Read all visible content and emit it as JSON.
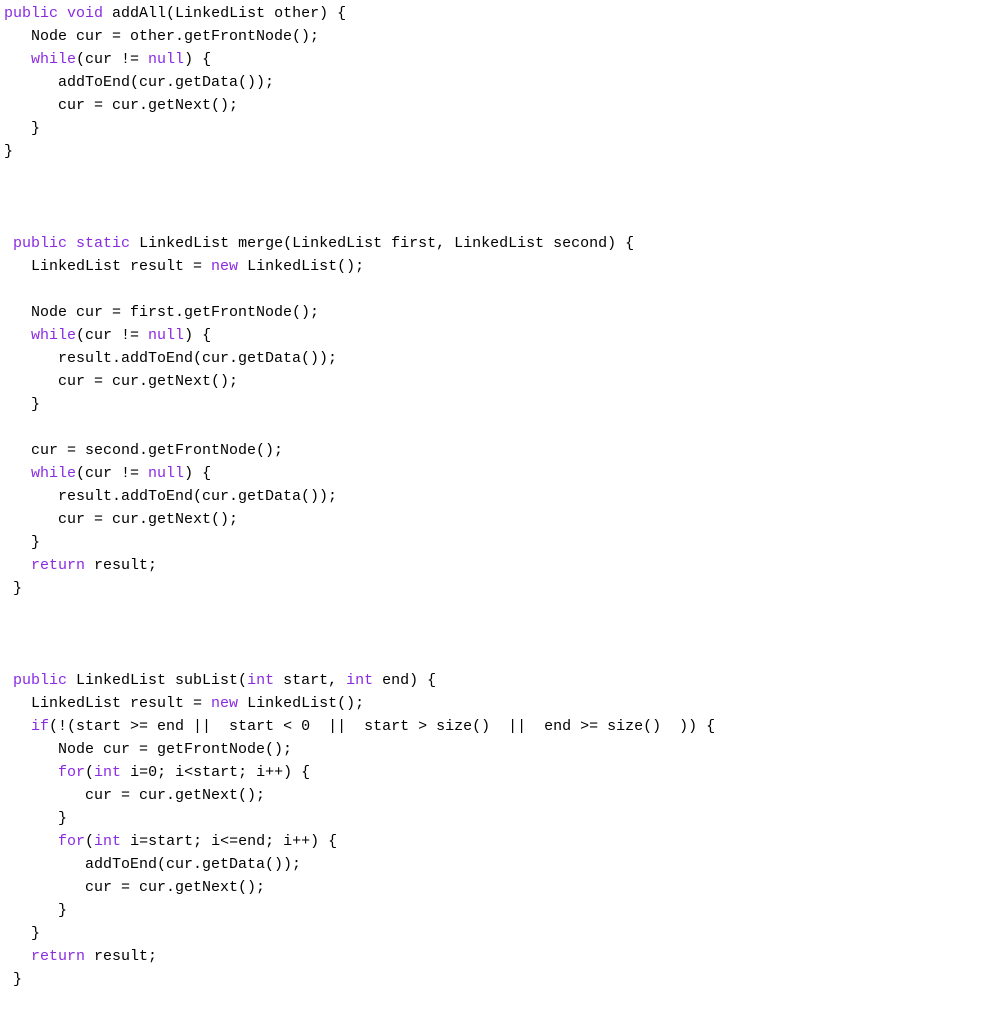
{
  "colors": {
    "keyword": "#8a2be2",
    "text": "#000000",
    "background": "#ffffff"
  },
  "keywords": [
    "public",
    "void",
    "static",
    "new",
    "int",
    "while",
    "for",
    "if",
    "return",
    "null"
  ],
  "code": {
    "tokens": [
      [
        [
          "kw",
          "public"
        ],
        [
          "p",
          " "
        ],
        [
          "kw",
          "void"
        ],
        [
          "p",
          " addAll(LinkedList other) {"
        ]
      ],
      [
        [
          "p",
          "   Node cur = other.getFrontNode();"
        ]
      ],
      [
        [
          "p",
          "   "
        ],
        [
          "kw",
          "while"
        ],
        [
          "p",
          "(cur != "
        ],
        [
          "kw",
          "null"
        ],
        [
          "p",
          ") {"
        ]
      ],
      [
        [
          "p",
          "      addToEnd(cur.getData());"
        ]
      ],
      [
        [
          "p",
          "      cur = cur.getNext();"
        ]
      ],
      [
        [
          "p",
          "   }"
        ]
      ],
      [
        [
          "p",
          "}"
        ]
      ],
      [
        [
          "p",
          ""
        ]
      ],
      [
        [
          "p",
          ""
        ]
      ],
      [
        [
          "p",
          ""
        ]
      ],
      [
        [
          "p",
          " "
        ],
        [
          "kw",
          "public"
        ],
        [
          "p",
          " "
        ],
        [
          "kw",
          "static"
        ],
        [
          "p",
          " LinkedList merge(LinkedList first, LinkedList second) {"
        ]
      ],
      [
        [
          "p",
          "   LinkedList result = "
        ],
        [
          "kw",
          "new"
        ],
        [
          "p",
          " LinkedList();"
        ]
      ],
      [
        [
          "p",
          ""
        ]
      ],
      [
        [
          "p",
          "   Node cur = first.getFrontNode();"
        ]
      ],
      [
        [
          "p",
          "   "
        ],
        [
          "kw",
          "while"
        ],
        [
          "p",
          "(cur != "
        ],
        [
          "kw",
          "null"
        ],
        [
          "p",
          ") {"
        ]
      ],
      [
        [
          "p",
          "      result.addToEnd(cur.getData());"
        ]
      ],
      [
        [
          "p",
          "      cur = cur.getNext();"
        ]
      ],
      [
        [
          "p",
          "   }"
        ]
      ],
      [
        [
          "p",
          ""
        ]
      ],
      [
        [
          "p",
          "   cur = second.getFrontNode();"
        ]
      ],
      [
        [
          "p",
          "   "
        ],
        [
          "kw",
          "while"
        ],
        [
          "p",
          "(cur != "
        ],
        [
          "kw",
          "null"
        ],
        [
          "p",
          ") {"
        ]
      ],
      [
        [
          "p",
          "      result.addToEnd(cur.getData());"
        ]
      ],
      [
        [
          "p",
          "      cur = cur.getNext();"
        ]
      ],
      [
        [
          "p",
          "   }"
        ]
      ],
      [
        [
          "p",
          "   "
        ],
        [
          "kw",
          "return"
        ],
        [
          "p",
          " result;"
        ]
      ],
      [
        [
          "p",
          " }"
        ]
      ],
      [
        [
          "p",
          ""
        ]
      ],
      [
        [
          "p",
          ""
        ]
      ],
      [
        [
          "p",
          ""
        ]
      ],
      [
        [
          "p",
          " "
        ],
        [
          "kw",
          "public"
        ],
        [
          "p",
          " LinkedList subList("
        ],
        [
          "kw",
          "int"
        ],
        [
          "p",
          " start, "
        ],
        [
          "kw",
          "int"
        ],
        [
          "p",
          " end) {"
        ]
      ],
      [
        [
          "p",
          "   LinkedList result = "
        ],
        [
          "kw",
          "new"
        ],
        [
          "p",
          " LinkedList();"
        ]
      ],
      [
        [
          "p",
          "   "
        ],
        [
          "kw",
          "if"
        ],
        [
          "p",
          "(!(start >= end ||  start < "
        ],
        [
          "num",
          "0"
        ],
        [
          "p",
          "  ||  start > size()  ||  end >= size()  )) {"
        ]
      ],
      [
        [
          "p",
          "      Node cur = getFrontNode();"
        ]
      ],
      [
        [
          "p",
          "      "
        ],
        [
          "kw",
          "for"
        ],
        [
          "p",
          "("
        ],
        [
          "kw",
          "int"
        ],
        [
          "p",
          " i="
        ],
        [
          "num",
          "0"
        ],
        [
          "p",
          "; i<start; i++) {"
        ]
      ],
      [
        [
          "p",
          "         cur = cur.getNext();"
        ]
      ],
      [
        [
          "p",
          "      }"
        ]
      ],
      [
        [
          "p",
          "      "
        ],
        [
          "kw",
          "for"
        ],
        [
          "p",
          "("
        ],
        [
          "kw",
          "int"
        ],
        [
          "p",
          " i=start; i<=end; i++) {"
        ]
      ],
      [
        [
          "p",
          "         addToEnd(cur.getData());"
        ]
      ],
      [
        [
          "p",
          "         cur = cur.getNext();"
        ]
      ],
      [
        [
          "p",
          "      }"
        ]
      ],
      [
        [
          "p",
          "   }"
        ]
      ],
      [
        [
          "p",
          "   "
        ],
        [
          "kw",
          "return"
        ],
        [
          "p",
          " result;"
        ]
      ],
      [
        [
          "p",
          " }"
        ]
      ]
    ]
  }
}
